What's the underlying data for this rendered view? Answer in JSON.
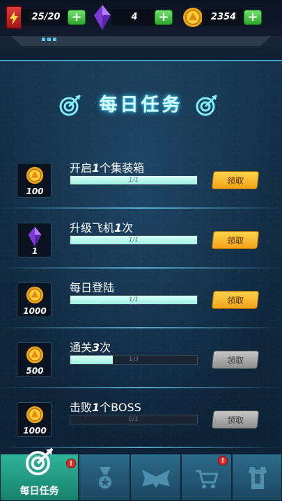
{
  "resources": {
    "energy": "25/20",
    "gems": "4",
    "coins": "2354"
  },
  "title": "每日任务",
  "tasks": [
    {
      "name_pre": "开启",
      "name_em": "1",
      "name_post": "个集装箱",
      "reward_icon": "gold-coin-icon",
      "reward": "100",
      "progress": "1/1",
      "progress_fraction": 1.0,
      "claim": "领取",
      "claimable": true
    },
    {
      "name_pre": "升级飞机",
      "name_em": "1",
      "name_post": "次",
      "reward_icon": "purple-gem-icon",
      "reward": "1",
      "progress": "1/1",
      "progress_fraction": 1.0,
      "claim": "领取",
      "claimable": true
    },
    {
      "name_pre": "每日登陆",
      "name_em": "",
      "name_post": "",
      "reward_icon": "gold-coin-icon",
      "reward": "1000",
      "progress": "1/1",
      "progress_fraction": 1.0,
      "claim": "领取",
      "claimable": true
    },
    {
      "name_pre": "通关",
      "name_em": "3",
      "name_post": "次",
      "reward_icon": "gold-coin-icon",
      "reward": "500",
      "progress": "1/3",
      "progress_fraction": 0.333,
      "claim": "领取",
      "claimable": false
    },
    {
      "name_pre": "击败",
      "name_em": "1",
      "name_post": "个BOSS",
      "reward_icon": "gold-coin-icon",
      "reward": "1000",
      "progress": "0/1",
      "progress_fraction": 0.0,
      "claim": "领取",
      "claimable": false
    }
  ],
  "nav": {
    "tabs": [
      {
        "label": "每日任务",
        "icon": "target-icon",
        "badge": "!"
      },
      {
        "label": "",
        "icon": "medal-icon",
        "badge": ""
      },
      {
        "label": "",
        "icon": "wings-icon",
        "badge": ""
      },
      {
        "label": "",
        "icon": "cart-icon",
        "badge": "!"
      },
      {
        "label": "",
        "icon": "armor-icon",
        "badge": ""
      }
    ]
  },
  "colors": {
    "accent": "#3ad6ff",
    "claim_active": "#f2a21a",
    "claim_disabled": "#8d8d8d",
    "progress_fill": "#9ff1e1",
    "plus_button": "#2ea52e",
    "badge": "#e22a2a"
  }
}
